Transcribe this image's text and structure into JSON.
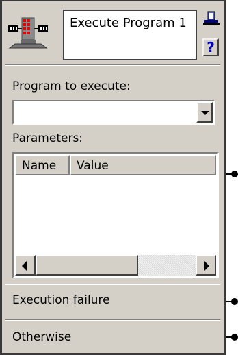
{
  "node": {
    "title": "Execute Program 1",
    "icon": "program-execute-icon",
    "pin_icon": "pin-icon",
    "help_label": "?"
  },
  "program": {
    "label": "Program to execute:",
    "value": ""
  },
  "parameters": {
    "label": "Parameters:",
    "columns": [
      "Name",
      "Value"
    ],
    "rows": []
  },
  "exits": [
    {
      "label": "Execution failure"
    },
    {
      "label": "Otherwise"
    }
  ]
}
